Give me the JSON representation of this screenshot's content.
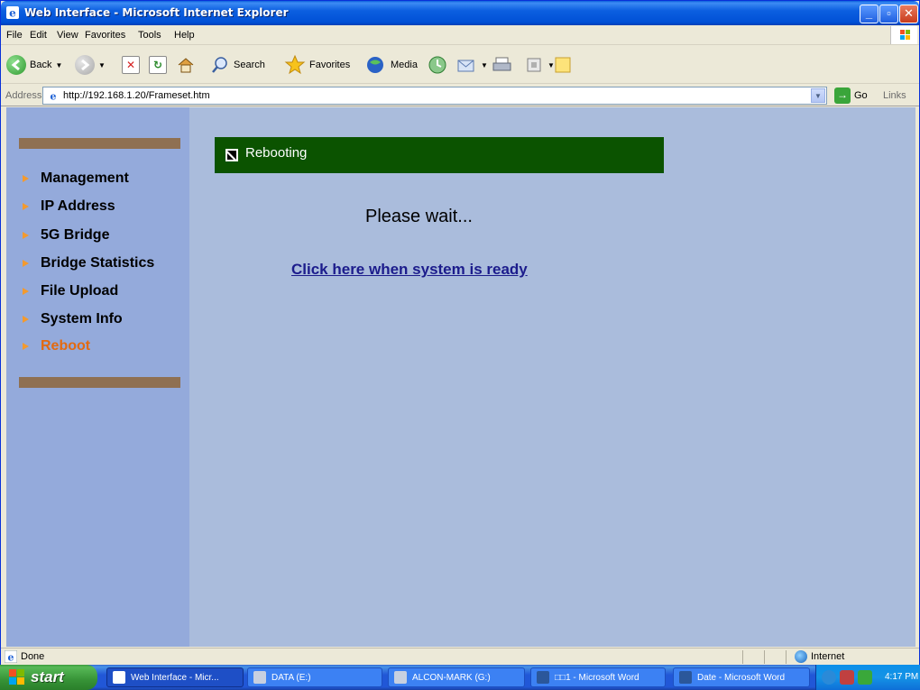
{
  "window": {
    "title": "Web Interface - Microsoft Internet Explorer"
  },
  "menu": [
    "File",
    "Edit",
    "View",
    "Favorites",
    "Tools",
    "Help"
  ],
  "toolbar": {
    "back": "Back",
    "search": "Search",
    "favorites": "Favorites",
    "media": "Media"
  },
  "address": {
    "label": "Address",
    "url": "http://192.168.1.20/Frameset.htm",
    "go": "Go",
    "links": "Links"
  },
  "nav": {
    "items": [
      {
        "label": "Management",
        "active": false
      },
      {
        "label": "IP Address",
        "active": false
      },
      {
        "label": "5G Bridge",
        "active": false
      },
      {
        "label": "Bridge Statistics",
        "active": false
      },
      {
        "label": "File Upload",
        "active": false
      },
      {
        "label": "System Info",
        "active": false
      },
      {
        "label": "Reboot",
        "active": true
      }
    ]
  },
  "main": {
    "header": "Rebooting",
    "wait": "Please wait...",
    "ready_link": "Click here when system is ready"
  },
  "status": {
    "text": "Done",
    "zone": "Internet"
  },
  "taskbar": {
    "start": "start",
    "tasks": [
      {
        "label": "Web Interface - Micr..."
      },
      {
        "label": "DATA (E:)"
      },
      {
        "label": "ALCON-MARK (G:)"
      },
      {
        "label": "□□1 - Microsoft Word"
      },
      {
        "label": "Date - Microsoft Word"
      }
    ],
    "clock": "4:17 PM"
  },
  "colors": {
    "header_bg": "#0b5300",
    "content_bg": "#aabcdc",
    "sidebar_bg": "#94aadb",
    "active_nav": "#e36a10",
    "nav_arrow": "#f39a2f",
    "link": "#1c1c8c"
  }
}
